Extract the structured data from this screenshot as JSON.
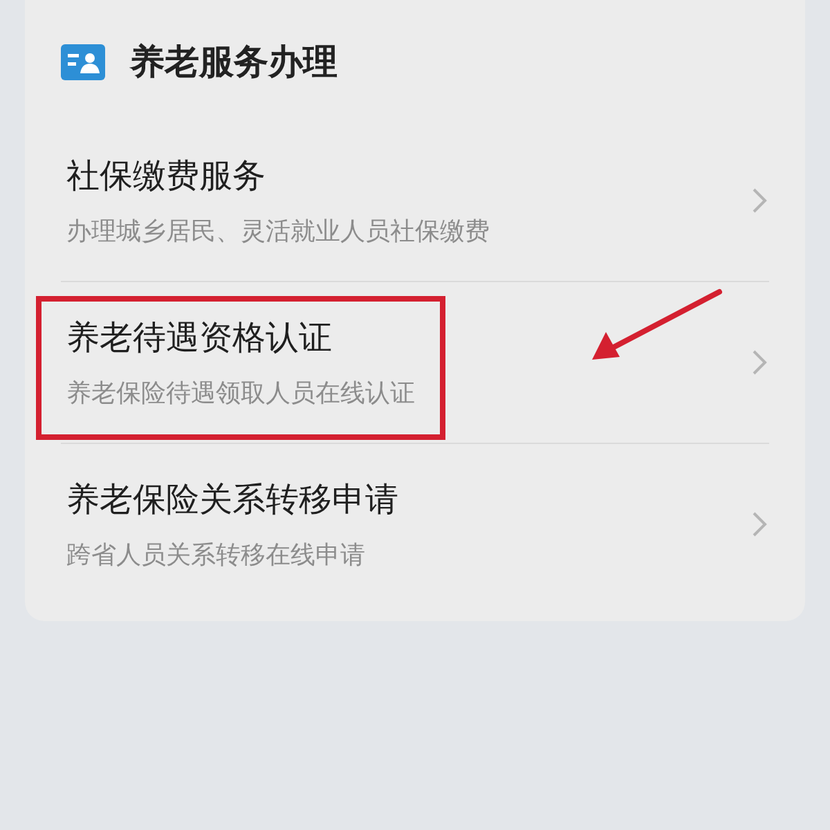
{
  "section": {
    "title": "养老服务办理"
  },
  "items": [
    {
      "title": "社保缴费服务",
      "subtitle": "办理城乡居民、灵活就业人员社保缴费",
      "highlighted": false
    },
    {
      "title": "养老待遇资格认证",
      "subtitle": "养老保险待遇领取人员在线认证",
      "highlighted": true
    },
    {
      "title": "养老保险关系转移申请",
      "subtitle": "跨省人员关系转移在线申请",
      "highlighted": false
    }
  ]
}
